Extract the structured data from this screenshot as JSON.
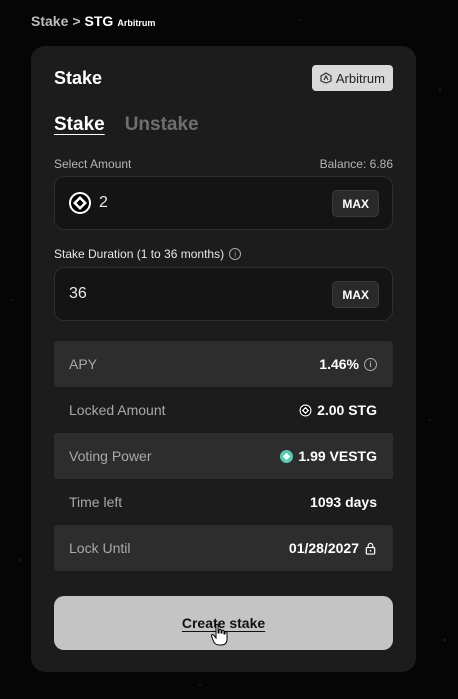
{
  "breadcrumb": {
    "root": "Stake",
    "sep": ">",
    "token": "STG",
    "network": "Arbitrum"
  },
  "card": {
    "title": "Stake",
    "network_badge": "Arbitrum"
  },
  "tabs": [
    {
      "label": "Stake",
      "active": true
    },
    {
      "label": "Unstake",
      "active": false
    }
  ],
  "amount": {
    "label": "Select Amount",
    "balance": "Balance: 6.86",
    "value": "2",
    "max_label": "MAX"
  },
  "duration": {
    "label": "Stake Duration (1 to 36 months)",
    "value": "36",
    "max_label": "MAX"
  },
  "info_rows": [
    {
      "key": "APY",
      "value": "1.46%"
    },
    {
      "key": "Locked Amount",
      "value": "2.00 STG"
    },
    {
      "key": "Voting Power",
      "value": "1.99 VESTG"
    },
    {
      "key": "Time left",
      "value": "1093 days"
    },
    {
      "key": "Lock Until",
      "value": "01/28/2027"
    }
  ],
  "create_button": "Create stake",
  "colors": {
    "vestg_icon": "#5bc8b0"
  }
}
